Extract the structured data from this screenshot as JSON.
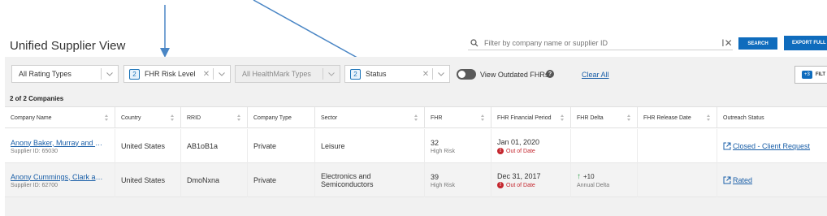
{
  "header": {
    "title": "Unified Supplier View",
    "search_placeholder": "Filter by company name or supplier ID",
    "search_button": "SEARCH",
    "export_button": "EXPORT FULL L"
  },
  "filters": {
    "rating_types": "All Rating Types",
    "fhr_risk_level": {
      "count": "2",
      "label": "FHR Risk Level"
    },
    "healthmark_types": "All HealthMark Types",
    "status": {
      "count": "2",
      "label": "Status"
    },
    "outdated_toggle_label": "View Outdated FHRs",
    "clear_all": "Clear All",
    "more_filters": {
      "badge": "+3",
      "label": "FILT"
    }
  },
  "table": {
    "count_text": "2 of 2 Companies",
    "columns": [
      "Company Name",
      "Country",
      "RRID",
      "Company Type",
      "Sector",
      "FHR",
      "FHR Financial Period",
      "FHR Delta",
      "FHR Release Date",
      "Outreach Status"
    ],
    "rows": [
      {
        "company": "Anony Baker, Murray and Hernandez",
        "supplier_id": "Supplier ID: 65030",
        "country": "United States",
        "rrid": "AB1oB1a",
        "type": "Private",
        "sector": "Leisure",
        "fhr": "32",
        "fhr_risk": "High Risk",
        "period": "Jan 01, 2020",
        "period_status": "Out of Date",
        "delta": "",
        "delta_label": "",
        "release_date": "",
        "outreach": "Closed - Client Request"
      },
      {
        "company": "Anony Cummings, Clark and Sons",
        "supplier_id": "Supplier ID: 62700",
        "country": "United States",
        "rrid": "DmoNxna",
        "type": "Private",
        "sector": "Electronics and Semiconductors",
        "fhr": "39",
        "fhr_risk": "High Risk",
        "period": "Dec 31, 2017",
        "period_status": "Out of Date",
        "delta": "+10",
        "delta_label": "Annual Delta",
        "release_date": "",
        "outreach": "Rated"
      }
    ]
  },
  "colors": {
    "primary_blue": "#0f6cbd",
    "link_blue": "#1a5fa8",
    "danger_red": "#c4262e",
    "positive_green": "#2e9e4a",
    "annotation_arrow": "#4a86c5"
  }
}
